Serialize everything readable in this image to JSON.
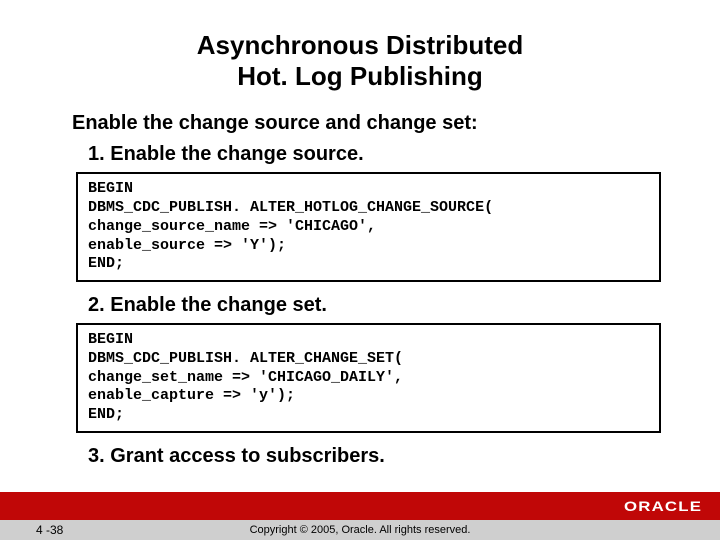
{
  "title_line1": "Asynchronous Distributed",
  "title_line2": "Hot. Log Publishing",
  "subhead": "Enable the change source and change set:",
  "steps": {
    "one": "1.  Enable the change source.",
    "two": "2.  Enable the change set.",
    "three": "3.  Grant access to subscribers."
  },
  "code1": "BEGIN\nDBMS_CDC_PUBLISH. ALTER_HOTLOG_CHANGE_SOURCE(\nchange_source_name => 'CHICAGO',\nenable_source => 'Y');\nEND;",
  "code2": "BEGIN\nDBMS_CDC_PUBLISH. ALTER_CHANGE_SET(\nchange_set_name => 'CHICAGO_DAILY',\nenable_capture => 'y');\nEND;",
  "footer": {
    "pageno": "4 -38",
    "copyright": "Copyright © 2005, Oracle. All rights reserved.",
    "logo": "ORACLE"
  }
}
